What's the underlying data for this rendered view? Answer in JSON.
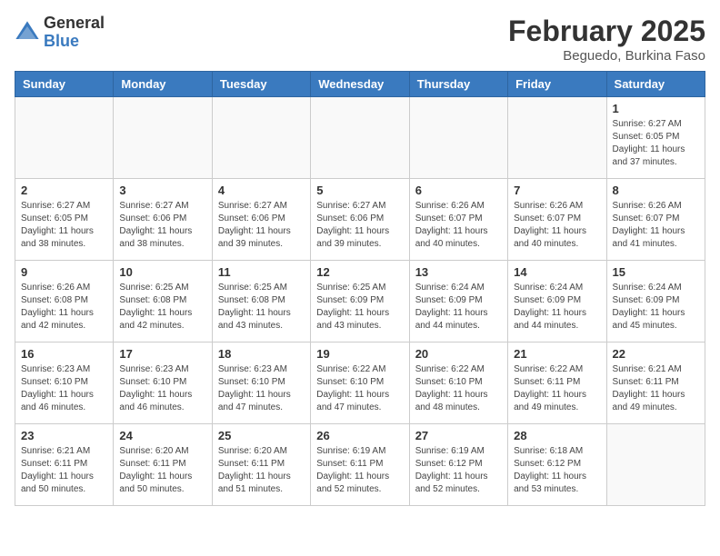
{
  "logo": {
    "general": "General",
    "blue": "Blue"
  },
  "title": "February 2025",
  "subtitle": "Beguedo, Burkina Faso",
  "weekdays": [
    "Sunday",
    "Monday",
    "Tuesday",
    "Wednesday",
    "Thursday",
    "Friday",
    "Saturday"
  ],
  "weeks": [
    [
      {
        "day": "",
        "info": ""
      },
      {
        "day": "",
        "info": ""
      },
      {
        "day": "",
        "info": ""
      },
      {
        "day": "",
        "info": ""
      },
      {
        "day": "",
        "info": ""
      },
      {
        "day": "",
        "info": ""
      },
      {
        "day": "1",
        "info": "Sunrise: 6:27 AM\nSunset: 6:05 PM\nDaylight: 11 hours\nand 37 minutes."
      }
    ],
    [
      {
        "day": "2",
        "info": "Sunrise: 6:27 AM\nSunset: 6:05 PM\nDaylight: 11 hours\nand 38 minutes."
      },
      {
        "day": "3",
        "info": "Sunrise: 6:27 AM\nSunset: 6:06 PM\nDaylight: 11 hours\nand 38 minutes."
      },
      {
        "day": "4",
        "info": "Sunrise: 6:27 AM\nSunset: 6:06 PM\nDaylight: 11 hours\nand 39 minutes."
      },
      {
        "day": "5",
        "info": "Sunrise: 6:27 AM\nSunset: 6:06 PM\nDaylight: 11 hours\nand 39 minutes."
      },
      {
        "day": "6",
        "info": "Sunrise: 6:26 AM\nSunset: 6:07 PM\nDaylight: 11 hours\nand 40 minutes."
      },
      {
        "day": "7",
        "info": "Sunrise: 6:26 AM\nSunset: 6:07 PM\nDaylight: 11 hours\nand 40 minutes."
      },
      {
        "day": "8",
        "info": "Sunrise: 6:26 AM\nSunset: 6:07 PM\nDaylight: 11 hours\nand 41 minutes."
      }
    ],
    [
      {
        "day": "9",
        "info": "Sunrise: 6:26 AM\nSunset: 6:08 PM\nDaylight: 11 hours\nand 42 minutes."
      },
      {
        "day": "10",
        "info": "Sunrise: 6:25 AM\nSunset: 6:08 PM\nDaylight: 11 hours\nand 42 minutes."
      },
      {
        "day": "11",
        "info": "Sunrise: 6:25 AM\nSunset: 6:08 PM\nDaylight: 11 hours\nand 43 minutes."
      },
      {
        "day": "12",
        "info": "Sunrise: 6:25 AM\nSunset: 6:09 PM\nDaylight: 11 hours\nand 43 minutes."
      },
      {
        "day": "13",
        "info": "Sunrise: 6:24 AM\nSunset: 6:09 PM\nDaylight: 11 hours\nand 44 minutes."
      },
      {
        "day": "14",
        "info": "Sunrise: 6:24 AM\nSunset: 6:09 PM\nDaylight: 11 hours\nand 44 minutes."
      },
      {
        "day": "15",
        "info": "Sunrise: 6:24 AM\nSunset: 6:09 PM\nDaylight: 11 hours\nand 45 minutes."
      }
    ],
    [
      {
        "day": "16",
        "info": "Sunrise: 6:23 AM\nSunset: 6:10 PM\nDaylight: 11 hours\nand 46 minutes."
      },
      {
        "day": "17",
        "info": "Sunrise: 6:23 AM\nSunset: 6:10 PM\nDaylight: 11 hours\nand 46 minutes."
      },
      {
        "day": "18",
        "info": "Sunrise: 6:23 AM\nSunset: 6:10 PM\nDaylight: 11 hours\nand 47 minutes."
      },
      {
        "day": "19",
        "info": "Sunrise: 6:22 AM\nSunset: 6:10 PM\nDaylight: 11 hours\nand 47 minutes."
      },
      {
        "day": "20",
        "info": "Sunrise: 6:22 AM\nSunset: 6:10 PM\nDaylight: 11 hours\nand 48 minutes."
      },
      {
        "day": "21",
        "info": "Sunrise: 6:22 AM\nSunset: 6:11 PM\nDaylight: 11 hours\nand 49 minutes."
      },
      {
        "day": "22",
        "info": "Sunrise: 6:21 AM\nSunset: 6:11 PM\nDaylight: 11 hours\nand 49 minutes."
      }
    ],
    [
      {
        "day": "23",
        "info": "Sunrise: 6:21 AM\nSunset: 6:11 PM\nDaylight: 11 hours\nand 50 minutes."
      },
      {
        "day": "24",
        "info": "Sunrise: 6:20 AM\nSunset: 6:11 PM\nDaylight: 11 hours\nand 50 minutes."
      },
      {
        "day": "25",
        "info": "Sunrise: 6:20 AM\nSunset: 6:11 PM\nDaylight: 11 hours\nand 51 minutes."
      },
      {
        "day": "26",
        "info": "Sunrise: 6:19 AM\nSunset: 6:11 PM\nDaylight: 11 hours\nand 52 minutes."
      },
      {
        "day": "27",
        "info": "Sunrise: 6:19 AM\nSunset: 6:12 PM\nDaylight: 11 hours\nand 52 minutes."
      },
      {
        "day": "28",
        "info": "Sunrise: 6:18 AM\nSunset: 6:12 PM\nDaylight: 11 hours\nand 53 minutes."
      },
      {
        "day": "",
        "info": ""
      }
    ]
  ]
}
